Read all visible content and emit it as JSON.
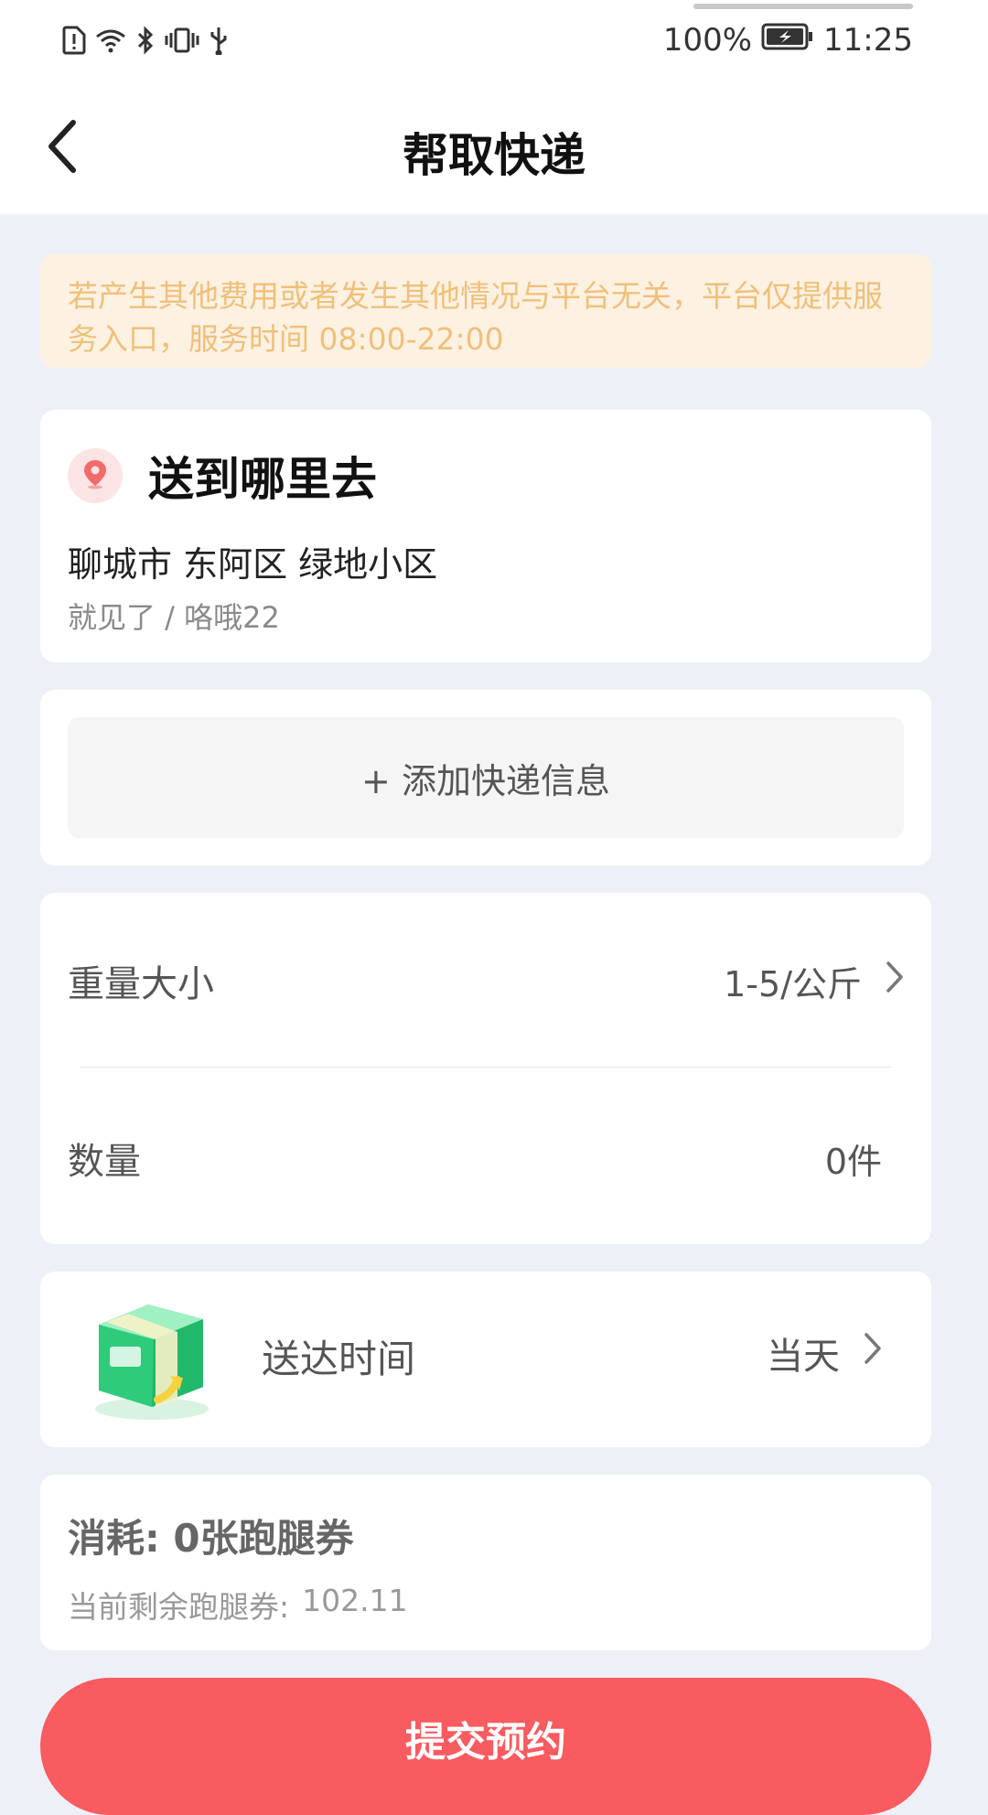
{
  "status_bar": {
    "battery": "100%",
    "time": "11:25"
  },
  "header": {
    "title": "帮取快递"
  },
  "notice": {
    "text": "若产生其他费用或者发生其他情况与平台无关，平台仅提供服务入口，服务时间 08:00-22:00"
  },
  "destination": {
    "title": "送到哪里去",
    "address": "聊城市 东阿区 绿地小区",
    "contact": "就见了 / 咯哦22"
  },
  "add_package": {
    "label": "+ 添加快递信息"
  },
  "form": {
    "weight_label": "重量大小",
    "weight_value": "1-5/公斤",
    "quantity_label": "数量",
    "quantity_value": "0件"
  },
  "delivery_time": {
    "label": "送达时间",
    "value": "当天"
  },
  "cost": {
    "consume": "消耗:  0张跑腿券",
    "balance_label": "当前剩余跑腿券:",
    "balance_value": "102.11"
  },
  "submit": {
    "label": "提交预约"
  },
  "colors": {
    "accent": "#f85b60",
    "notice_bg": "#fdf1e2",
    "notice_text": "#f0c07a",
    "page_bg": "#edf1f7"
  },
  "icons": [
    "sim-alert-icon",
    "wifi-icon",
    "bluetooth-icon",
    "vibrate-icon",
    "usb-icon",
    "battery-charging-icon",
    "back-arrow-icon",
    "location-pin-icon",
    "chevron-right-icon",
    "package-icon"
  ]
}
